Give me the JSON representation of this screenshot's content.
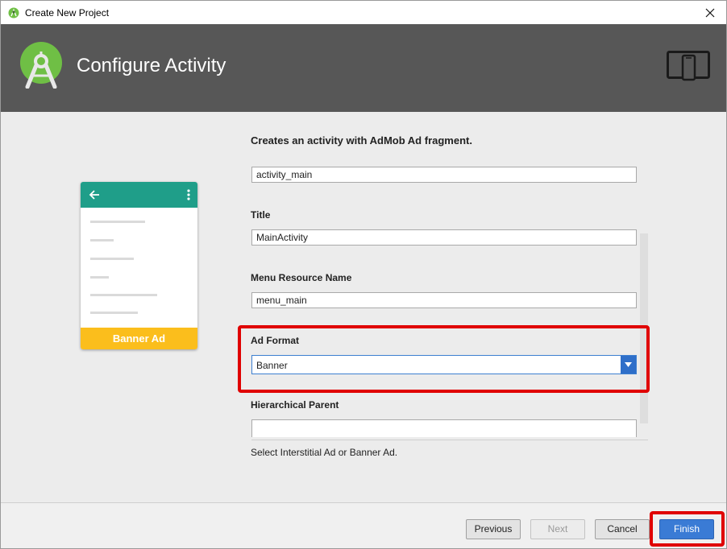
{
  "window": {
    "title": "Create New Project"
  },
  "header": {
    "title": "Configure Activity"
  },
  "preview": {
    "banner_label": "Banner Ad"
  },
  "form": {
    "description": "Creates an activity with AdMob Ad fragment.",
    "layout_name_value": "activity_main",
    "title_label": "Title",
    "title_value": "MainActivity",
    "menu_label": "Menu Resource Name",
    "menu_value": "menu_main",
    "ad_format_label": "Ad Format",
    "ad_format_value": "Banner",
    "parent_label": "Hierarchical Parent",
    "parent_value": "",
    "hint": "Select Interstitial Ad or Banner Ad."
  },
  "buttons": {
    "previous": "Previous",
    "next": "Next",
    "cancel": "Cancel",
    "finish": "Finish"
  },
  "colors": {
    "header_bg": "#575757",
    "preview_toolbar": "#1f9e89",
    "banner": "#fbbe1c",
    "highlight": "#e00000",
    "primary_button": "#3a7bd5"
  },
  "icons": {
    "app": "android-studio-icon",
    "header_logo": "android-studio-logo-icon",
    "device": "phone-tablet-icon",
    "close": "close-icon",
    "back": "arrow-left-icon",
    "overflow": "more-vert-icon",
    "dropdown": "chevron-down-icon"
  }
}
